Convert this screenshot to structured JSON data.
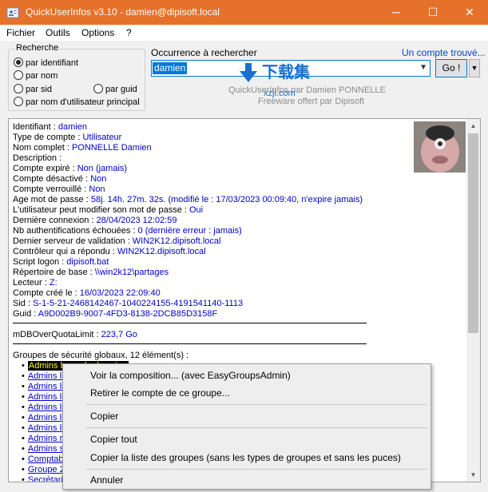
{
  "window": {
    "title": "QuickUserInfos v3.10 - damien@dipisoft.local",
    "minimize_glyph": "─",
    "maximize_glyph": "☐",
    "close_glyph": "✕"
  },
  "menu": [
    "Fichier",
    "Outils",
    "Options",
    "?"
  ],
  "search": {
    "group_label": "Recherche",
    "options": [
      "par identifiant",
      "par nom",
      "par sid",
      "par guid",
      "par nom d'utilisateur principal"
    ],
    "selected": "par identifiant",
    "occurrence_label": "Occurrence à rechercher",
    "found_link": "Un compte trouvé...",
    "input_value": "damien",
    "go_label": "Go !",
    "dropdown_glyph": "▼"
  },
  "info": {
    "line1": "QuickUserInfos par Damien PONNELLE",
    "line2": "Freeware offert par Dipisoft"
  },
  "watermark": {
    "text": "下载集",
    "sub": "xzji.com"
  },
  "details": {
    "fields": [
      {
        "key": "Identifiant : ",
        "value": "damien"
      },
      {
        "key": "Type de compte : ",
        "value": "Utilisateur"
      },
      {
        "key": "Nom complet : ",
        "value": "PONNELLE Damien"
      },
      {
        "key": "Description : ",
        "value": ""
      },
      {
        "key": "Compte expiré : ",
        "value": "Non (jamais)"
      },
      {
        "key": "Compte désactivé : ",
        "value": "Non"
      },
      {
        "key": "Compte verrouillé : ",
        "value": "Non"
      },
      {
        "key": "Age mot de passe : ",
        "value": "58j. 14h. 27m. 32s. (modifié le : 17/03/2023 00:09:40, n'expire jamais)"
      },
      {
        "key": "L'utilisateur peut modifier son mot de passe : ",
        "value": "Oui"
      },
      {
        "key": "Dernière connexion : ",
        "value": "28/04/2023 12:02:59"
      },
      {
        "key": "Nb authentifications échouées : ",
        "value": "0 (dernière erreur : jamais)"
      },
      {
        "key": "Dernier serveur de validation : ",
        "value": "WIN2K12.dipisoft.local"
      },
      {
        "key": "Contrôleur qui a répondu : ",
        "value": "WIN2K12.dipisoft.local"
      },
      {
        "key": "Script logon : ",
        "value": "dipisoft.bat"
      },
      {
        "key": "Répertoire de base : ",
        "value": "\\\\win2k12\\partages"
      },
      {
        "key": "Lecteur : ",
        "value": "Z:"
      },
      {
        "key": "Compte créé le : ",
        "value": "16/03/2023 22:09:40"
      },
      {
        "key": "Sid : ",
        "value": "S-1-5-21-2468142467-1040224155-4191541140-1113"
      },
      {
        "key": "Guid : ",
        "value": "A9D002B9-9007-4FD3-8138-2DCB85D3158F"
      }
    ],
    "quota": {
      "key": "mDBOverQuotaLimit : ",
      "value": "223,7 Go"
    },
    "groups_header": "Groupes de sécurité globaux, 12 élément(s) :",
    "groups": [
      {
        "name": "Admins base de données",
        "selected": true
      },
      {
        "name": "Admins lis"
      },
      {
        "name": "Admins lis"
      },
      {
        "name": "Admins lis"
      },
      {
        "name": "Admins lis"
      },
      {
        "name": "Admins lis"
      },
      {
        "name": "Admins lis"
      },
      {
        "name": "Admins re"
      },
      {
        "name": "Admins s"
      },
      {
        "name": "Comptab"
      },
      {
        "name": "Groupe 2"
      },
      {
        "name": "Secrétari"
      }
    ],
    "scroll_up_glyph": "▲",
    "scroll_down_glyph": "▼"
  },
  "context_menu": {
    "items": [
      "Voir la composition... (avec EasyGroupsAdmin)",
      "Retirer le compte de ce groupe...",
      "Copier",
      "Copier tout",
      "Copier la liste des groupes (sans les types de groupes et sans les puces)",
      "Annuler"
    ]
  }
}
